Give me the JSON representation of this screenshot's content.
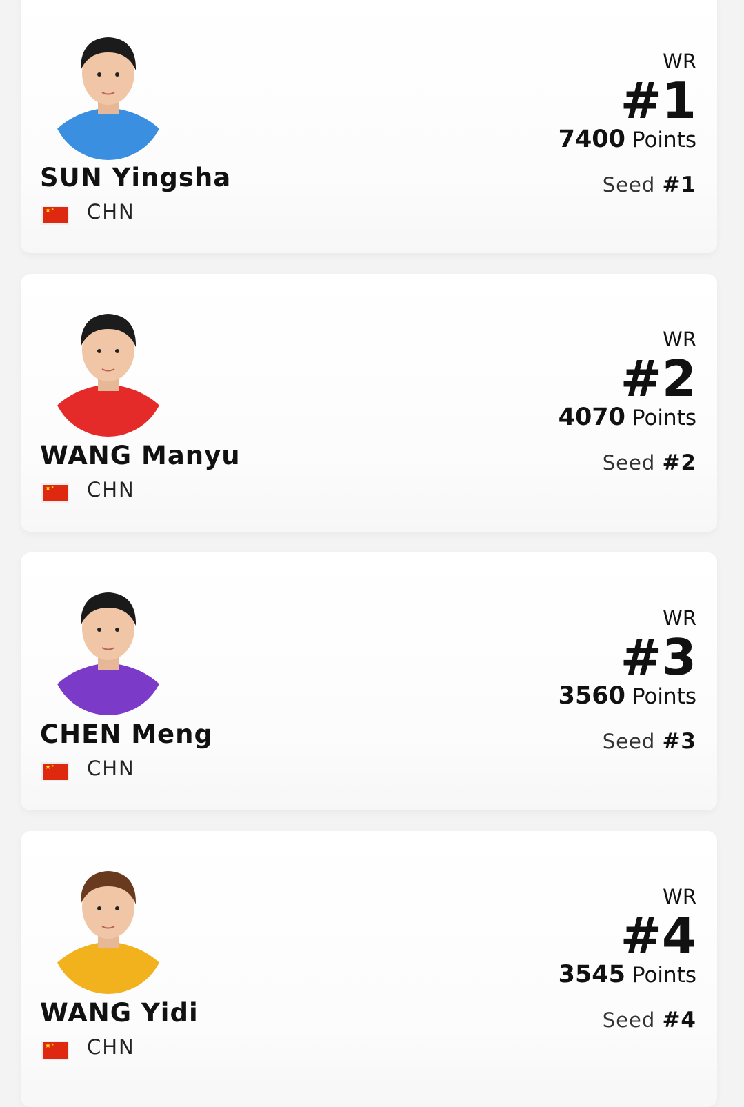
{
  "players": [
    {
      "name": "SUN Yingsha",
      "country": "CHN",
      "wr_label": "WR",
      "rank": "#1",
      "points": "7400",
      "points_label": "Points",
      "seed_label": "Seed",
      "seed": "#1",
      "jersey_color": "#3a8fe0",
      "hair_color": "#1b1b1b"
    },
    {
      "name": "WANG Manyu",
      "country": "CHN",
      "wr_label": "WR",
      "rank": "#2",
      "points": "4070",
      "points_label": "Points",
      "seed_label": "Seed",
      "seed": "#2",
      "jersey_color": "#e52a2a",
      "hair_color": "#1c1c1c"
    },
    {
      "name": "CHEN Meng",
      "country": "CHN",
      "wr_label": "WR",
      "rank": "#3",
      "points": "3560",
      "points_label": "Points",
      "seed_label": "Seed",
      "seed": "#3",
      "jersey_color": "#7b3ac8",
      "hair_color": "#1a1a1a"
    },
    {
      "name": "WANG Yidi",
      "country": "CHN",
      "wr_label": "WR",
      "rank": "#4",
      "points": "3545",
      "points_label": "Points",
      "seed_label": "Seed",
      "seed": "#4",
      "jersey_color": "#f2b21e",
      "hair_color": "#6a3a1e"
    }
  ],
  "flag_color": "#de2910"
}
